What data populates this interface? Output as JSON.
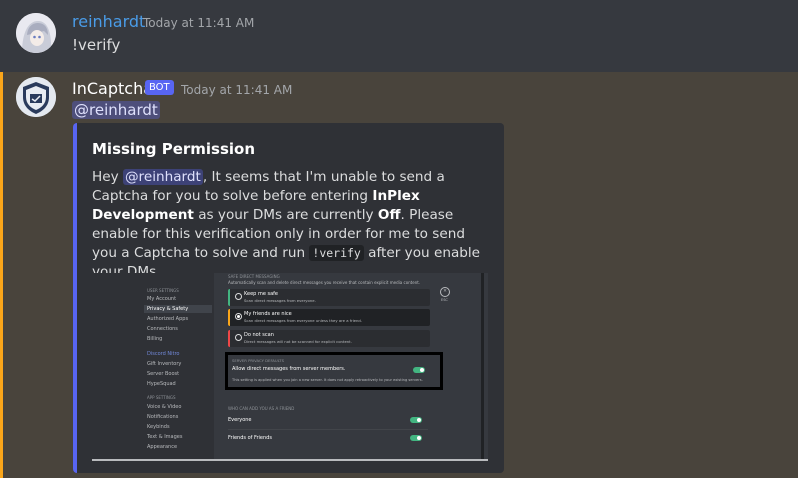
{
  "messages": [
    {
      "username": "reinhardt",
      "timestamp": "Today at 11:41 AM",
      "text": "!verify",
      "username_color": "#4a9ce8"
    },
    {
      "username": "InCaptcha",
      "badge": "BOT",
      "timestamp": "Today at 11:41 AM",
      "mention": "@reinhardt",
      "embed": {
        "title": "Missing Permission",
        "desc": {
          "p1": "Hey ",
          "mention": "@reinhardt",
          "p2": ", It seems that I'm unable to send a Captcha for you to solve before entering ",
          "server": "InPlex Development",
          "p3": " as your DMs are currently ",
          "state": "Off",
          "p4": ". Please enable for this verification only in order for me to send you a Captcha to solve and run ",
          "command": "!verify",
          "p5": " after you enable your DMs."
        }
      }
    }
  ],
  "screenshot": {
    "sidebar": {
      "header1": "USER SETTINGS",
      "items1": [
        "My Account",
        "Privacy & Safety",
        "Authorized Apps",
        "Connections",
        "Billing"
      ],
      "nitro": "Discord Nitro",
      "items2": [
        "Gift Inventory",
        "Server Boost",
        "HypeSquad"
      ],
      "header2": "APP SETTINGS",
      "items3": [
        "Voice & Video",
        "Notifications",
        "Keybinds",
        "Text & Images",
        "Appearance"
      ]
    },
    "dm_header": "SAFE DIRECT MESSAGING",
    "dm_sub": "Automatically scan and delete direct messages you receive that contain explicit media content.",
    "options": [
      {
        "title": "Keep me safe",
        "sub": "Scan direct messages from everyone."
      },
      {
        "title": "My friends are nice",
        "sub": "Scan direct messages from everyone unless they are a friend."
      },
      {
        "title": "Do not scan",
        "sub": "Direct messages will not be scanned for explicit content."
      }
    ],
    "esc": "ESC",
    "privacy_header": "SERVER PRIVACY DEFAULTS",
    "privacy_label": "Allow direct messages from server members.",
    "privacy_note": "This setting is applied when you join a new server. It does not apply retroactively to your existing servers.",
    "friend_header": "WHO CAN ADD YOU AS A FRIEND",
    "friend_items": [
      "Everyone",
      "Friends of Friends"
    ]
  }
}
